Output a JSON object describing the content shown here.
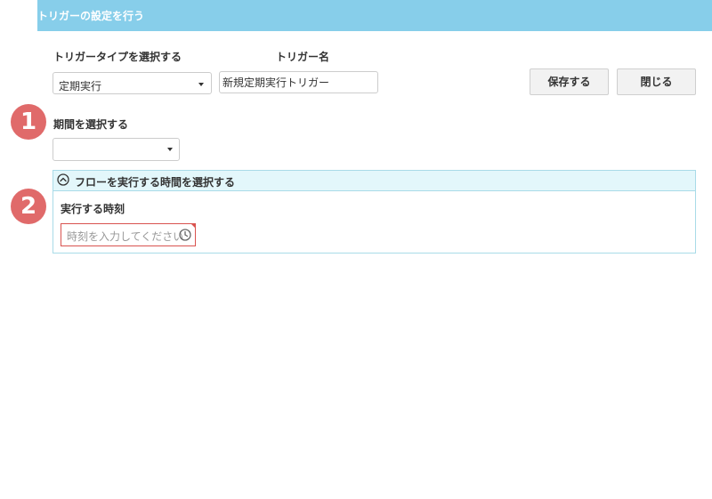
{
  "header": {
    "title": "トリガーの設定を行う"
  },
  "trigger_type": {
    "label": "トリガータイプを選択する",
    "selected": "定期実行"
  },
  "trigger_name": {
    "label": "トリガー名",
    "value": "新規定期実行トリガー"
  },
  "buttons": {
    "save": "保存する",
    "close": "閉じる"
  },
  "steps": {
    "one": "1",
    "two": "2"
  },
  "period": {
    "label": "期間を選択する",
    "selected": ""
  },
  "time_panel": {
    "title": "フローを実行する時間を選択する",
    "field_label": "実行する時刻",
    "placeholder": "時刻を入力してください"
  },
  "colors": {
    "header_bg": "#87ceea",
    "step_badge": "#e06a6a",
    "panel_border": "#a9dbe8",
    "panel_header_bg": "#e3f7fb",
    "error_border": "#d9534f"
  },
  "icons": {
    "collapse": "chevron-up-circle-icon",
    "clock": "clock-icon",
    "dropdown": "caret-down-icon"
  }
}
